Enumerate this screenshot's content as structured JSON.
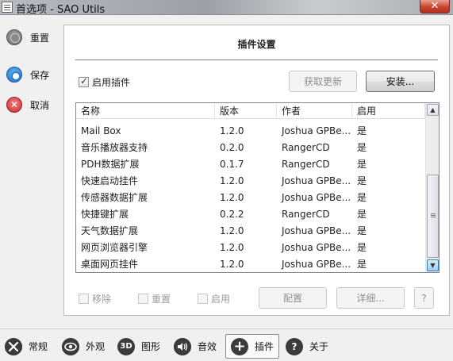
{
  "window": {
    "title": "首选项 - SAO Utils",
    "close": "✕"
  },
  "side_actions": [
    {
      "label": "重置"
    },
    {
      "label": "保存"
    },
    {
      "label": "取消"
    }
  ],
  "panel": {
    "title": "插件设置",
    "enable_plugins_label": "启用插件",
    "fetch_updates_label": "获取更新",
    "install_label": "安装..."
  },
  "table": {
    "columns": [
      "名称",
      "版本",
      "作者",
      "启用"
    ],
    "rows": [
      {
        "name": "Mail Box",
        "version": "1.2.0",
        "author": "Joshua GPBe...",
        "enabled": "是"
      },
      {
        "name": "音乐播放器支持",
        "version": "0.2.0",
        "author": "RangerCD",
        "enabled": "是"
      },
      {
        "name": "PDH数据扩展",
        "version": "0.1.7",
        "author": "RangerCD",
        "enabled": "是"
      },
      {
        "name": "快速启动挂件",
        "version": "1.2.0",
        "author": "Joshua GPBe...",
        "enabled": "是"
      },
      {
        "name": "传感器数据扩展",
        "version": "1.2.0",
        "author": "Joshua GPBe...",
        "enabled": "是"
      },
      {
        "name": "快捷键扩展",
        "version": "0.2.2",
        "author": "RangerCD",
        "enabled": "是"
      },
      {
        "name": "天气数据扩展",
        "version": "1.2.0",
        "author": "Joshua GPBe...",
        "enabled": "是"
      },
      {
        "name": "网页浏览器引擎",
        "version": "1.2.0",
        "author": "Joshua GPBe...",
        "enabled": "是"
      },
      {
        "name": "桌面网页挂件",
        "version": "1.2.0",
        "author": "Joshua GPBe...",
        "enabled": "是"
      }
    ]
  },
  "footer": {
    "remove_label": "移除",
    "reset_label": "重置",
    "enable_label": "启用",
    "configure_label": "配置",
    "details_label": "详细...",
    "help_label": "?"
  },
  "tabs": [
    {
      "label": "常规",
      "icon": "wrench-icon"
    },
    {
      "label": "外观",
      "icon": "eye-icon"
    },
    {
      "label": "图形",
      "icon": "3d-icon"
    },
    {
      "label": "音效",
      "icon": "speaker-icon"
    },
    {
      "label": "插件",
      "icon": "plus-icon"
    },
    {
      "label": "关于",
      "icon": "question-icon"
    }
  ],
  "icon_glyphs": {
    "3d": "3D",
    "plus": "+",
    "question": "?",
    "cancel": "✕"
  }
}
